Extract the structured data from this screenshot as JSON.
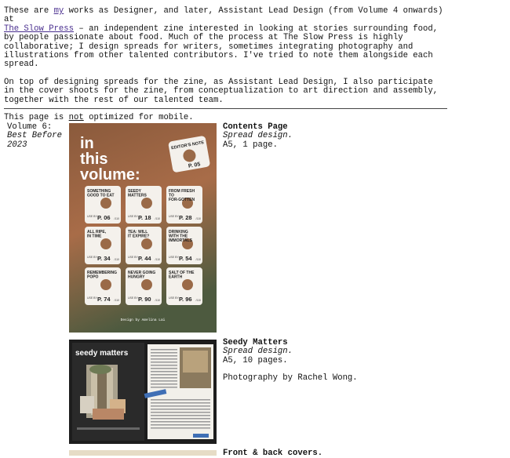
{
  "intro": {
    "p1_a": "These are ",
    "p1_link_my": "my",
    "p1_b": " works as Designer, and later, Assistant Lead Design (from Volume 4 onwards) at",
    "p1_link_slowpress": "The Slow Press",
    "p1_c": " – an independent zine interested in looking at stories surrounding food, by people passionate about food. Much of the process at The Slow Press is highly collaborative; I design spreads for writers, sometimes integrating photography and illustrations from other talented contributors. I've tried to note them alongside each spread.",
    "p2": "On top of designing spreads for the zine, as Assistant Lead Design, I also participate in the cover shoots for the zine, from conceptualization to art direction and assembly, together with the rest of our talented team.",
    "p3_a": "This page is ",
    "p3_not": "not",
    "p3_b": " optimized for mobile."
  },
  "volume": {
    "label": "Volume 6:",
    "subtitle": "Best Before 2023"
  },
  "works": [
    {
      "title": "Contents Page",
      "type": "Spread design.",
      "meta": "A5, 1 page.",
      "credit": ""
    },
    {
      "title": "Seedy Matters",
      "type": "Spread design.",
      "meta": "A5, 10 pages.",
      "credit": "Photography by Rachel Wong."
    },
    {
      "title": "Front & back covers.",
      "type": "",
      "meta": "",
      "credit": ""
    }
  ],
  "contents_image": {
    "heading_line1": "in",
    "heading_line2": "this",
    "heading_line3": "volume:",
    "editors_note": "EDITOR'S NOTE",
    "editors_page": "P. 05",
    "tags": [
      {
        "title": "SOMETHING GOOD TO EAT",
        "page": "P. 06"
      },
      {
        "title": "SEEDY MATTERS",
        "page": "P. 18"
      },
      {
        "title": "FROM FRESH TO FOR-GOTTEN",
        "page": "P. 28"
      },
      {
        "title": "ALL RIPE, IN TIME",
        "page": "P. 34"
      },
      {
        "title": "TEA: WILL IT EXPIRE?",
        "page": "P. 44"
      },
      {
        "title": "DRINKING WITH THE IMMORTALS",
        "page": "P. 54"
      },
      {
        "title": "REMEMBERING POPO",
        "page": "P. 74"
      },
      {
        "title": "NEVER GOING HUNGRY",
        "page": "P. 90"
      },
      {
        "title": "SALT OF THE EARTH",
        "page": "P. 96"
      }
    ],
    "page_total": "/110",
    "use_by": "USE BY",
    "credit": "Design by Amelina Lai"
  },
  "seedy_image": {
    "title": "seedy matters"
  },
  "colors": {
    "link": "#4a2f8f",
    "text": "#111111",
    "contents_bg_top": "#8a5a3c",
    "contents_bg_bottom": "#4d5a3f",
    "seedy_bg": "#1d1d1d"
  }
}
